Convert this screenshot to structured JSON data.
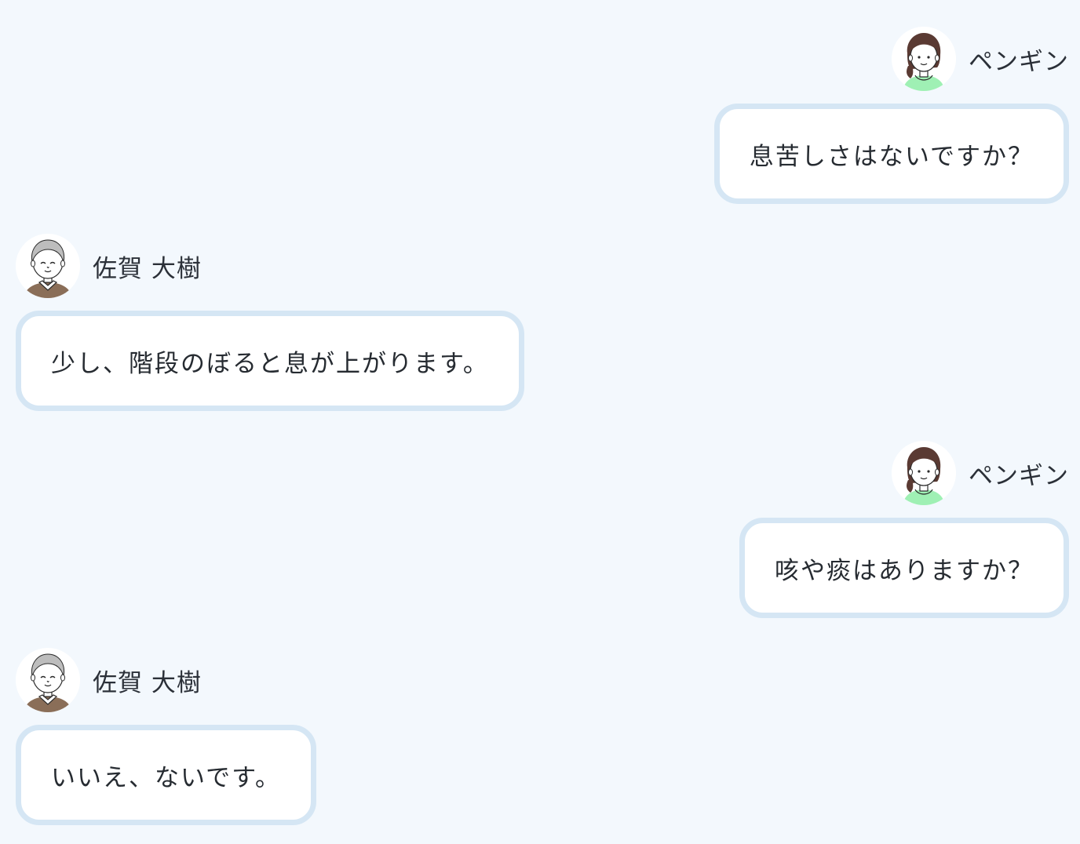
{
  "messages": [
    {
      "side": "right",
      "sender": "ペンギン",
      "avatar": "nurse-avatar-icon",
      "text": "息苦しさはないですか？"
    },
    {
      "side": "left",
      "sender": "佐賀 大樹",
      "avatar": "elderly-man-avatar-icon",
      "text": "少し、階段のぼると息が上がります。"
    },
    {
      "side": "right",
      "sender": "ペンギン",
      "avatar": "nurse-avatar-icon",
      "text": "咳や痰はありますか？"
    },
    {
      "side": "left",
      "sender": "佐賀 大樹",
      "avatar": "elderly-man-avatar-icon",
      "text": "いいえ、ないです。"
    }
  ],
  "colors": {
    "background": "#f3f8fd",
    "bubble_border": "#d5e6f4",
    "bubble_fill": "#ffffff",
    "text": "#262b31",
    "nurse_shirt": "#9ff0b4",
    "man_sweater": "#8a6e58"
  }
}
